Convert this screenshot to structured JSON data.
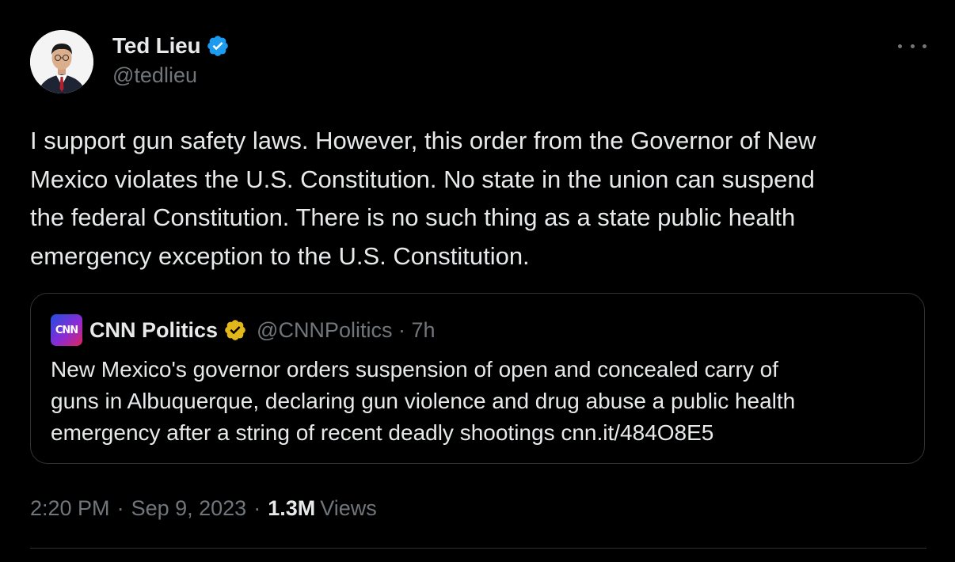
{
  "author": {
    "display_name": "Ted Lieu",
    "handle": "@tedlieu",
    "verified_badge": "blue-check",
    "badge_color": "#1d9bf0"
  },
  "more_icon": "ellipsis-horizontal-icon",
  "tweet": {
    "lines": [
      "I support gun safety laws. However, this order from the Governor of New",
      "Mexico violates the U.S. Constitution. No state in the union can suspend",
      "the federal Constitution. There is no such thing as a state public health",
      "emergency exception to the U.S. Constitution."
    ]
  },
  "quote": {
    "avatar_text": "CNN",
    "display_name": "CNN Politics",
    "verified_badge": "gold-check",
    "badge_color": "#e2b719",
    "handle_time": "@CNNPolitics · 7h",
    "lines": [
      "New Mexico's governor orders suspension of open and concealed carry of",
      "guns in Albuquerque, declaring gun violence and drug abuse a public health",
      "emergency after a string of recent deadly shootings cnn.it/484O8E5"
    ]
  },
  "meta": {
    "time": "2:20 PM",
    "separator": "·",
    "date": "Sep 9, 2023",
    "views_count": "1.3M",
    "views_label": "Views"
  },
  "colors": {
    "background": "#000000",
    "text_primary": "#e7e9ea",
    "text_secondary": "#71767b",
    "border": "#2f3336"
  }
}
